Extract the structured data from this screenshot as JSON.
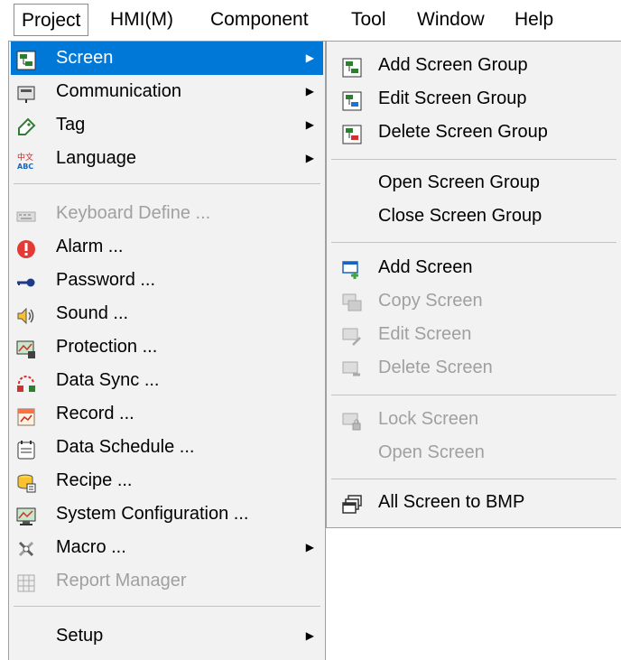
{
  "menubar": {
    "items": [
      "Project",
      "HMI(M)",
      "Component",
      "Tool",
      "Window",
      "Help"
    ]
  },
  "main_menu": {
    "items": [
      {
        "label": "Screen",
        "icon": "screen-group-icon",
        "submenu": true,
        "highlighted": true,
        "enabled": true
      },
      {
        "label": "Communication",
        "icon": "communication-icon",
        "submenu": true,
        "enabled": true
      },
      {
        "label": "Tag",
        "icon": "tag-icon",
        "submenu": true,
        "enabled": true
      },
      {
        "label": "Language",
        "icon": "language-icon",
        "submenu": true,
        "enabled": true
      },
      {
        "label": "Keyboard Define ...",
        "icon": "keyboard-icon",
        "enabled": false
      },
      {
        "label": "Alarm ...",
        "icon": "alarm-icon",
        "enabled": true
      },
      {
        "label": "Password ...",
        "icon": "password-key-icon",
        "enabled": true
      },
      {
        "label": "Sound ...",
        "icon": "speaker-icon",
        "enabled": true
      },
      {
        "label": "Protection ...",
        "icon": "protection-icon",
        "enabled": true
      },
      {
        "label": "Data Sync ...",
        "icon": "data-sync-icon",
        "enabled": true
      },
      {
        "label": "Record ...",
        "icon": "record-icon",
        "enabled": true
      },
      {
        "label": "Data Schedule ...",
        "icon": "data-schedule-icon",
        "enabled": true
      },
      {
        "label": "Recipe ...",
        "icon": "recipe-icon",
        "enabled": true
      },
      {
        "label": "System Configuration ...",
        "icon": "system-configuration-icon",
        "enabled": true
      },
      {
        "label": "Macro ...",
        "icon": "macro-icon",
        "submenu": true,
        "enabled": true
      },
      {
        "label": "Report Manager",
        "icon": "report-manager-icon",
        "enabled": false
      },
      {
        "label": "Setup",
        "submenu": true,
        "enabled": true
      }
    ]
  },
  "sub_menu": {
    "items": [
      {
        "label": "Add Screen Group",
        "icon": "add-screen-group-icon",
        "enabled": true
      },
      {
        "label": "Edit Screen Group",
        "icon": "edit-screen-group-icon",
        "enabled": true
      },
      {
        "label": "Delete Screen Group",
        "icon": "delete-screen-group-icon",
        "enabled": true
      },
      {
        "label": "Open Screen Group",
        "enabled": true
      },
      {
        "label": "Close Screen Group",
        "enabled": true
      },
      {
        "label": "Add Screen",
        "icon": "add-screen-icon",
        "enabled": true
      },
      {
        "label": "Copy Screen",
        "icon": "copy-screen-icon",
        "enabled": false
      },
      {
        "label": "Edit Screen",
        "icon": "edit-screen-icon",
        "enabled": false
      },
      {
        "label": "Delete Screen",
        "icon": "delete-screen-icon",
        "enabled": false
      },
      {
        "label": "Lock Screen",
        "icon": "lock-screen-icon",
        "enabled": false
      },
      {
        "label": "Open Screen",
        "enabled": false
      },
      {
        "label": "All Screen to BMP",
        "icon": "all-screen-to-bmp-icon",
        "enabled": true
      }
    ]
  },
  "colors": {
    "highlight": "#0078d7",
    "menu_bg": "#f2f2f2",
    "disabled_text": "#a0a0a0"
  }
}
